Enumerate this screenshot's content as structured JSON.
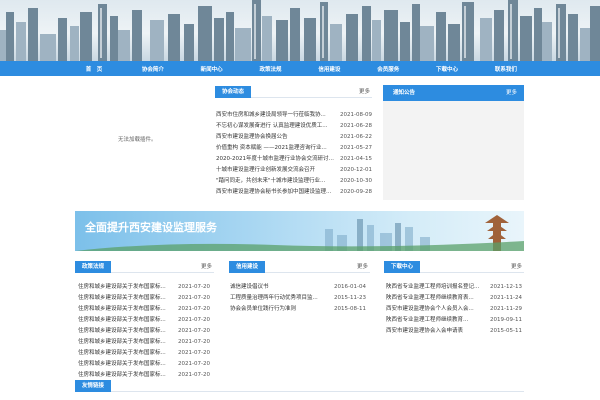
{
  "nav": {
    "items": [
      "首　页",
      "协会简介",
      "新闻中心",
      "政策法规",
      "信用建设",
      "会员服务",
      "下载中心",
      "联系我们"
    ]
  },
  "plugin": {
    "message": "无法加载插件。"
  },
  "association_news": {
    "title": "协会动态",
    "more": "更多",
    "items": [
      {
        "title": "西安市住房和城乡建设局领导一行莅临我协...",
        "date": "2021-08-09"
      },
      {
        "title": "不忘初心谋发展奋进行 认真监理建设优质工...",
        "date": "2021-06-28"
      },
      {
        "title": "西安市建设监理协会换届公告",
        "date": "2021-06-22"
      },
      {
        "title": "价值重构 资本赋能 ——2021监理咨询行业...",
        "date": "2021-05-27"
      },
      {
        "title": "2020-2021年度十城市监理行业协会交流研讨会...",
        "date": "2021-04-15"
      },
      {
        "title": "十城市建设监理行业创新发展交流会召开",
        "date": "2020-12-01"
      },
      {
        "title": "\"踏问同走，共创未来\"十城市建设监理行业...",
        "date": "2020-10-30"
      },
      {
        "title": "西安市建设监理协会秘书长参加中国建设监理...",
        "date": "2020-09-28"
      }
    ]
  },
  "notice": {
    "title": "通知公告",
    "more": "更多"
  },
  "slogan": {
    "text": "全面提升西安建设监理服务"
  },
  "policy": {
    "title": "政策法规",
    "more": "更多",
    "items": [
      {
        "title": "住房和城乡建设部关于发布国家标...",
        "date": "2021-07-20"
      },
      {
        "title": "住房和城乡建设部关于发布国家标...",
        "date": "2021-07-20"
      },
      {
        "title": "住房和城乡建设部关于发布国家标...",
        "date": "2021-07-20"
      },
      {
        "title": "住房和城乡建设部关于发布国家标...",
        "date": "2021-07-20"
      },
      {
        "title": "住房和城乡建设部关于发布国家标...",
        "date": "2021-07-20"
      },
      {
        "title": "住房和城乡建设部关于发布国家标...",
        "date": "2021-07-20"
      },
      {
        "title": "住房和城乡建设部关于发布国家标...",
        "date": "2021-07-20"
      },
      {
        "title": "住房和城乡建设部关于发布国家标...",
        "date": "2021-07-20"
      },
      {
        "title": "住房和城乡建设部关于发布国家标...",
        "date": "2021-07-20"
      }
    ]
  },
  "credit": {
    "title": "信用建设",
    "more": "更多",
    "items": [
      {
        "title": "诚信建设倡议书",
        "date": "2016-01-04"
      },
      {
        "title": "工程质量治理两年行动优秀项目监...",
        "date": "2015-11-23"
      },
      {
        "title": "协会会员单位践行行为准则",
        "date": "2015-08-11"
      }
    ]
  },
  "downloads": {
    "title": "下载中心",
    "more": "更多",
    "items": [
      {
        "title": "陕西省专业监理工程师培训报名登记...",
        "date": "2021-12-13"
      },
      {
        "title": "陕西省专业监理工程师继续教育表...",
        "date": "2021-11-24"
      },
      {
        "title": "西安市建设监理协会个人会员入会...",
        "date": "2021-11-29"
      },
      {
        "title": "陕西省专业监理工程师继续教育...",
        "date": "2019-09-11"
      },
      {
        "title": "西安市建设监理协会入会申请表",
        "date": "2015-05-11"
      }
    ]
  },
  "links": {
    "title": "友情链接"
  },
  "colors": {
    "primary": "#2d8ce0",
    "panel_bg": "#f3f3f3"
  }
}
